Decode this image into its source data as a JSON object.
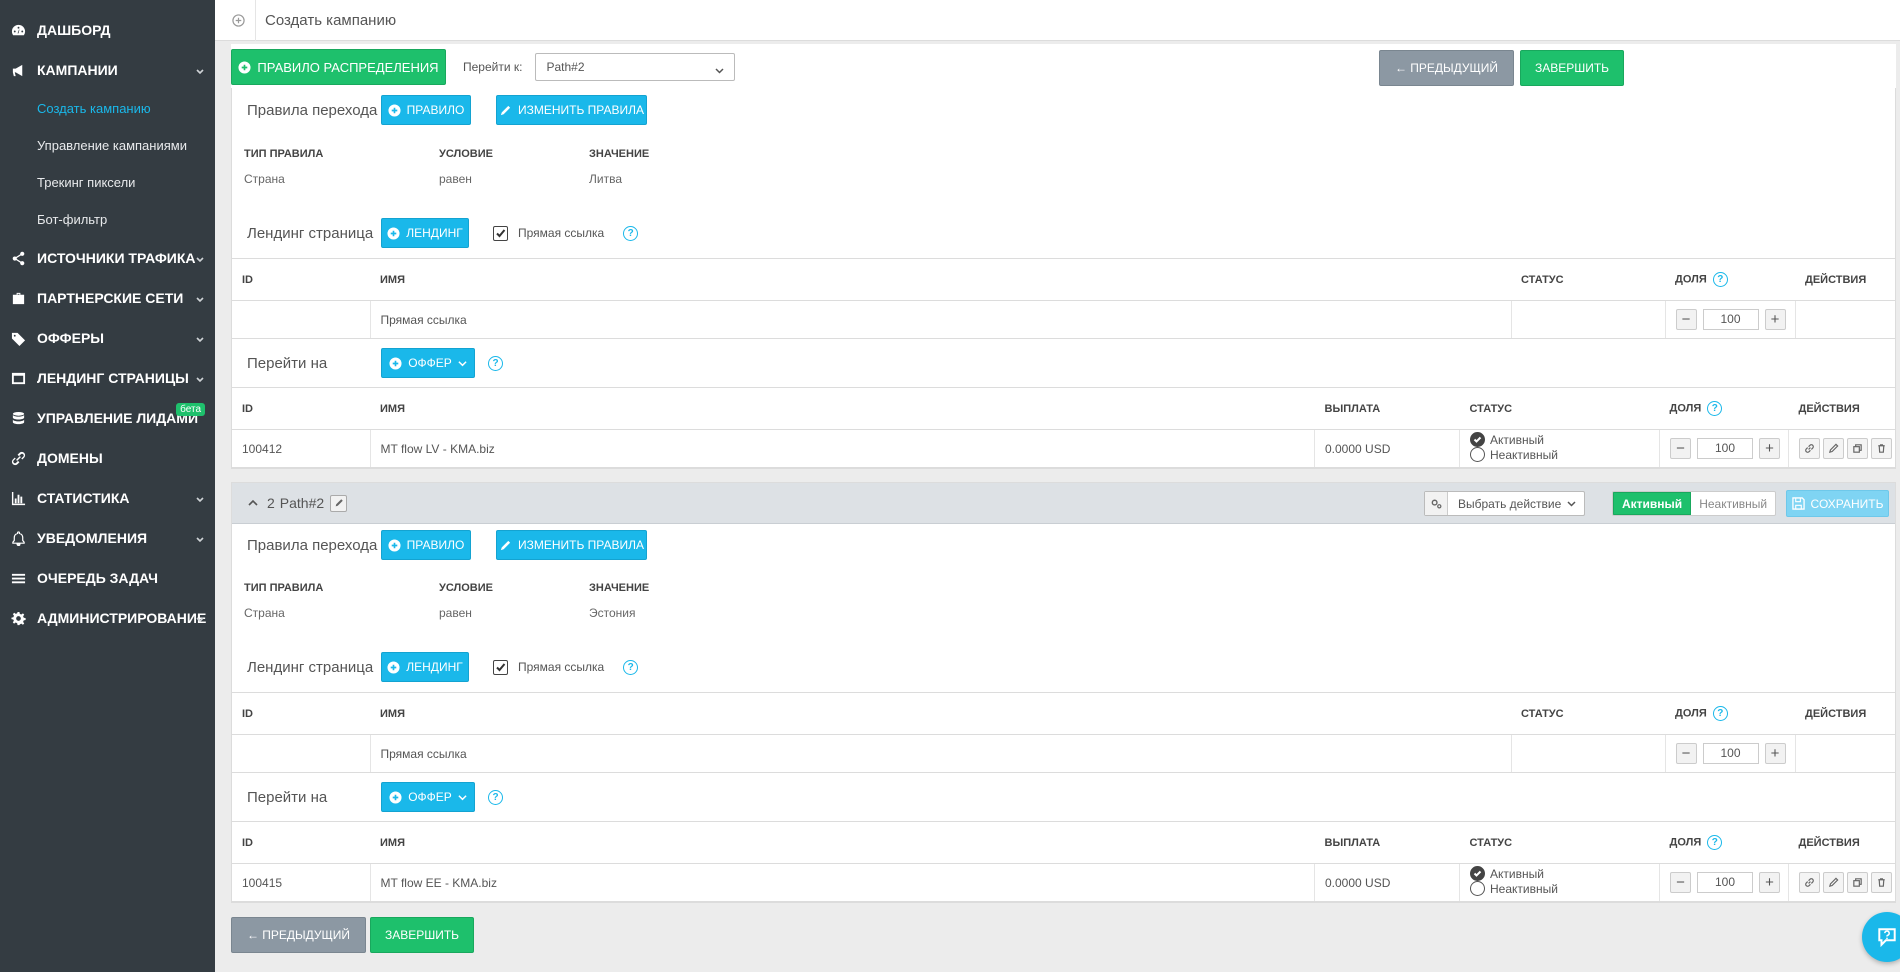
{
  "sidebar": {
    "items": [
      {
        "label": "Дашборд",
        "icon": "dashboard-icon"
      },
      {
        "label": "Кампании",
        "icon": "megaphone-icon",
        "expanded": true,
        "children": [
          "Создать кампанию",
          "Управление кампаниями",
          "Трекинг пиксели",
          "Бот-фильтр"
        ]
      },
      {
        "label": "Источники трафика",
        "icon": "share-icon"
      },
      {
        "label": "Партнерские сети",
        "icon": "briefcase-icon"
      },
      {
        "label": "Офферы",
        "icon": "tags-icon"
      },
      {
        "label": "Лендинг страницы",
        "icon": "window-icon"
      },
      {
        "label": "Управление лидами",
        "icon": "database-icon",
        "badge": "бета"
      },
      {
        "label": "Домены",
        "icon": "link-icon"
      },
      {
        "label": "Статистика",
        "icon": "bar-chart-icon"
      },
      {
        "label": "Уведомления",
        "icon": "bell-icon"
      },
      {
        "label": "Очередь задач",
        "icon": "list-icon"
      },
      {
        "label": "Администрирование",
        "icon": "gear-icon"
      }
    ]
  },
  "topbar": {
    "title": "Создать кампанию"
  },
  "toolbar": {
    "distribution_rule": "Правило распределения",
    "goto_label": "Перейти к:",
    "goto_value": "Path#2",
    "prev": "← Предыдущий",
    "finish": "Завершить"
  },
  "common": {
    "transition_rules": "Правила перехода",
    "rule_btn": "Правило",
    "edit_rules_btn": "Изменить правила",
    "col_rule_type": "Тип правила",
    "col_condition": "Условие",
    "col_value": "Значение",
    "landing_label": "Лендинг страница",
    "landing_btn": "Лендинг",
    "direct_link": "Прямая ссылка",
    "col_id": "ID",
    "col_name": "Имя",
    "col_status": "Статус",
    "col_share": "Доля",
    "col_actions": "Действия",
    "col_payout": "Выплата",
    "goto_on": "Перейти на",
    "offer_btn": "Оффер",
    "active": "Активный",
    "inactive": "Неактивный",
    "select_action": "Выбрать действие",
    "seg_active": "Активный",
    "seg_inactive": "Неактивный",
    "save": "Сохранить"
  },
  "path1": {
    "rule": {
      "type": "Страна",
      "condition": "равен",
      "value": "Литва"
    },
    "landing_row": {
      "name": "Прямая ссылка",
      "share": "100"
    },
    "offer_row": {
      "id": "100412",
      "name": "MT flow LV - KMA.biz",
      "payout": "0.0000 USD",
      "share": "100"
    }
  },
  "path2": {
    "number": "2",
    "title": "Path#2",
    "rule": {
      "type": "Страна",
      "condition": "равен",
      "value": "Эстония"
    },
    "landing_row": {
      "name": "Прямая ссылка",
      "share": "100"
    },
    "offer_row": {
      "id": "100415",
      "name": "MT flow EE - KMA.biz",
      "payout": "0.0000 USD",
      "share": "100"
    }
  },
  "footer": {
    "prev": "← Предыдущий",
    "finish": "Завершить"
  },
  "colors": {
    "sidebar": "#343c42",
    "green": "#1ec06c",
    "blue": "#1ab8ea",
    "gray": "#8c98a3",
    "accent": "#1ab8ea"
  }
}
